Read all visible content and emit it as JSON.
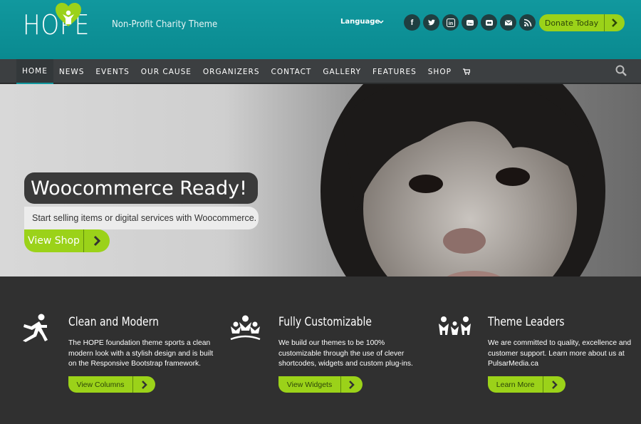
{
  "header": {
    "logo_text": "HOPE",
    "tagline": "Non-Profit Charity Theme",
    "language_label": "Language",
    "socials": [
      {
        "name": "facebook",
        "glyph": "f"
      },
      {
        "name": "twitter",
        "glyph": "t"
      },
      {
        "name": "linkedin",
        "glyph": "in"
      },
      {
        "name": "youtube",
        "glyph": "You"
      },
      {
        "name": "flickr",
        "glyph": "••"
      },
      {
        "name": "email",
        "glyph": "✉"
      },
      {
        "name": "rss",
        "glyph": "rss"
      }
    ],
    "donate_label": "Donate Today"
  },
  "nav": {
    "items": [
      "HOME",
      "NEWS",
      "EVENTS",
      "OUR CAUSE",
      "ORGANIZERS",
      "CONTACT",
      "GALLERY",
      "FEATURES",
      "SHOP"
    ],
    "active": "HOME",
    "cart_icon": "cart-icon",
    "search_icon": "search-icon"
  },
  "hero": {
    "title": "Woocommerce Ready!",
    "subtitle": "Start selling items or digital services with Woocommerce.",
    "button_label": "View Shop"
  },
  "features": [
    {
      "title": "Clean and Modern",
      "text": "The HOPE foundation theme sports a clean modern look with a stylish design and is built on the Responsive Bootstrap framework.",
      "button": "View Columns",
      "icon": "runner-icon"
    },
    {
      "title": "Fully Customizable",
      "text": "We build our themes to be 100% customizable through the use of clever shortcodes, widgets and custom plug-ins.",
      "button": "View Widgets",
      "icon": "people-group-icon"
    },
    {
      "title": "Theme Leaders",
      "text": "We are committed to quality, excellence and customer support. Learn more about us at PulsarMedia.ca",
      "button": "Learn More",
      "icon": "family-icon"
    }
  ],
  "colors": {
    "teal": "#11989e",
    "accent": "#9bd219",
    "nav": "#3c3f41",
    "footer": "#303030"
  }
}
